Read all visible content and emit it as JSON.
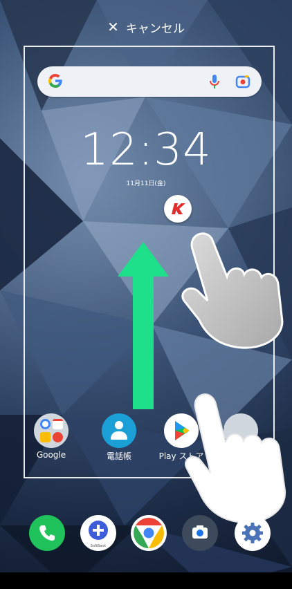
{
  "topbar": {
    "cancel_label": "キャンセル",
    "close_icon": "close-icon"
  },
  "search": {
    "google_icon": "google-g-icon",
    "mic_icon": "mic-icon",
    "lens_icon": "camera-lens-icon"
  },
  "clock": {
    "time": "12:34",
    "date": "11月11日(金)"
  },
  "apps": [
    {
      "name": "google-folder",
      "label": "Google"
    },
    {
      "name": "contacts",
      "label": "電話帳"
    },
    {
      "name": "play-store",
      "label": "Play ストア"
    },
    {
      "name": "folder-partial",
      "label": ""
    }
  ],
  "dock": [
    "phone-icon",
    "softbank-message-icon",
    "chrome-icon",
    "camera-icon",
    "settings-icon"
  ],
  "dock_sub": {
    "softbank": "SoftBank"
  },
  "colors": {
    "arrow": "#1fe08a",
    "accent_red": "#e22b2b"
  }
}
